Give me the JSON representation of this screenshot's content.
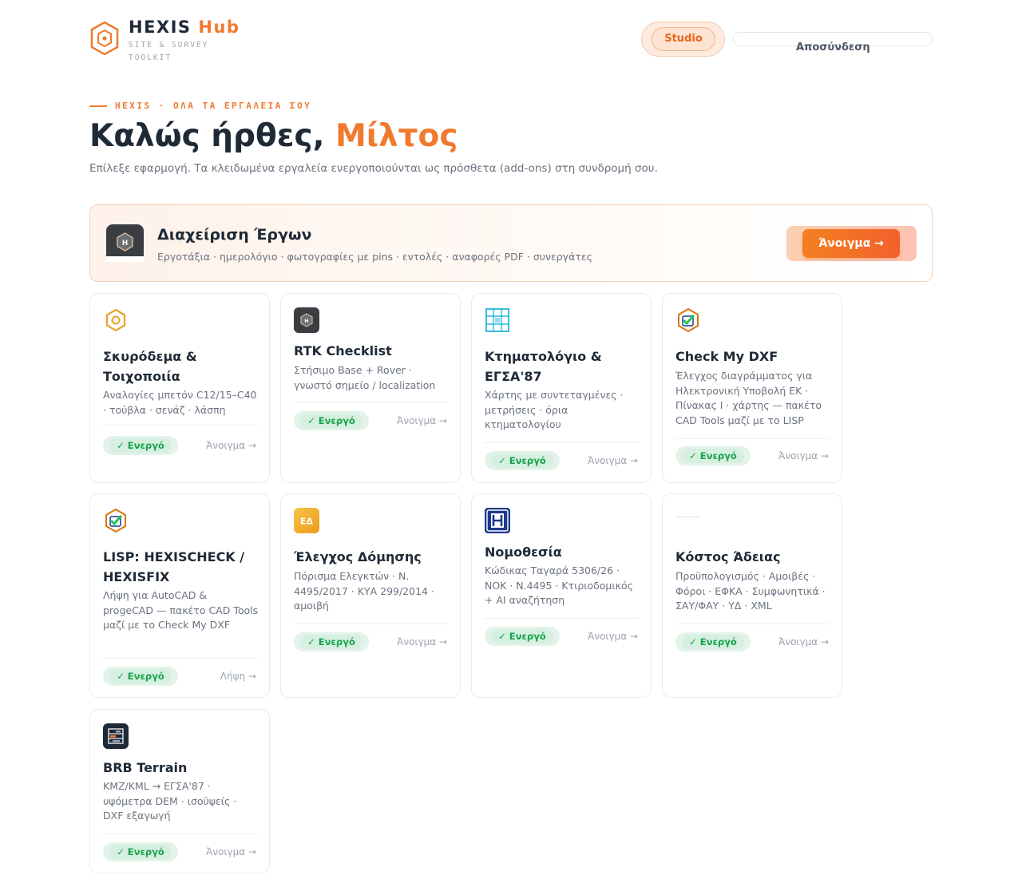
{
  "header": {
    "brand_name": "HEXIS",
    "brand_accent": "Hub",
    "brand_subtitle": "SITE & SURVEY TOOLKIT",
    "studio_label": "Studio",
    "logout_label": "Αποσύνδεση",
    "logo_icon": "hexagon-logo-icon"
  },
  "hero": {
    "eyebrow": "HEXIS · ΟΛΑ ΤΑ ΕΡΓΑΛΕΙΑ ΣΟΥ",
    "greeting": "Καλώς ήρθες, ",
    "name": "Μίλτος",
    "subtitle": "Επίλεξε εφαρμογή. Τα κλειδωμένα εργαλεία ενεργοποιούνται ως πρόσθετα (add-ons) στη συνδρομή σου."
  },
  "featured": {
    "title": "Διαχείριση Έργων",
    "subtitle": "Εργοτάξια · ημερολόγιο · φωτογραφίες με pins · εντολές · αναφορές PDF · συνεργάτες",
    "button": "Άνοιγμα →",
    "icon": "hexis-app-icon"
  },
  "cards": [
    {
      "title": "Σκυρόδεμα & Τοιχοποιία",
      "desc": "Αναλογίες μπετόν C12/15–C40 · τούβλα · σενάζ · λάσπη",
      "badge": "✓ Ενεργό",
      "link": "Άνοιγμα →",
      "icon": "hexagon-outline-icon"
    },
    {
      "title": "RTK Checklist",
      "desc": "Στήσιμο Base + Rover · γνωστό σημείο / localization",
      "badge": "✓ Ενεργό",
      "link": "Άνοιγμα →",
      "icon": "hexis-dark-icon"
    },
    {
      "title": "Κτηματολόγιο & ΕΓΣΑ'87",
      "desc": "Χάρτης με συντεταγμένες · μετρήσεις · όρια κτηματολογίου",
      "badge": "✓ Ενεργό",
      "link": "Άνοιγμα →",
      "icon": "grid-map-icon"
    },
    {
      "title": "Check My DXF",
      "desc": "Έλεγχος διαγράμματος για Ηλεκτρονική Υποβολή ΕΚ · Πίνακας Ι · χάρτης — πακέτο CAD Tools μαζί με το LISP",
      "badge": "✓ Ενεργό",
      "link": "Άνοιγμα →",
      "icon": "hexagon-check-icon"
    },
    {
      "title": "LISP: HEXISCHECK / HEXISFIX",
      "desc": "Λήψη για AutoCAD & progeCAD — πακέτο CAD Tools μαζί με το Check My DXF",
      "badge": "✓ Ενεργό",
      "link": "Λήψη →",
      "icon": "hexagon-check-icon"
    },
    {
      "title": "Έλεγχος Δόμησης",
      "desc": "Πόρισμα Ελεγκτών · Ν. 4495/2017 · ΚΥΑ 299/2014 · αμοιβή",
      "badge": "✓ Ενεργό",
      "link": "Άνοιγμα →",
      "icon": "ed-badge-icon",
      "icon_text": "ΕΔ"
    },
    {
      "title": "Νομοθεσία",
      "desc": "Κώδικας Ταγαρά 5306/26 · ΝΟΚ · Ν.4495 · Κτιριοδομικός + AI αναζήτηση",
      "badge": "✓ Ενεργό",
      "link": "Άνοιγμα →",
      "icon": "law-book-icon"
    },
    {
      "title": "Κόστος Άδειας",
      "desc": "Προϋπολογισμός · Αμοιβές · Φόροι · ΕΦΚΑ · Συμφωνητικά · ΣΑΥ/ΦΑΥ · ΥΔ · XML",
      "badge": "✓ Ενεργό",
      "link": "Άνοιγμα →",
      "icon": "broken-image-icon"
    },
    {
      "title": "BRB Terrain",
      "desc": "KMZ/KML → ΕΓΣΑ'87 · υψόμετρα DEM · ισοϋψείς · DXF εξαγωγή",
      "badge": "✓ Ενεργό",
      "link": "Άνοιγμα →",
      "icon": "terrain-layers-icon"
    }
  ],
  "colors": {
    "accent": "#f07a2e",
    "success": "#16a34a",
    "text": "#1f2a37"
  }
}
